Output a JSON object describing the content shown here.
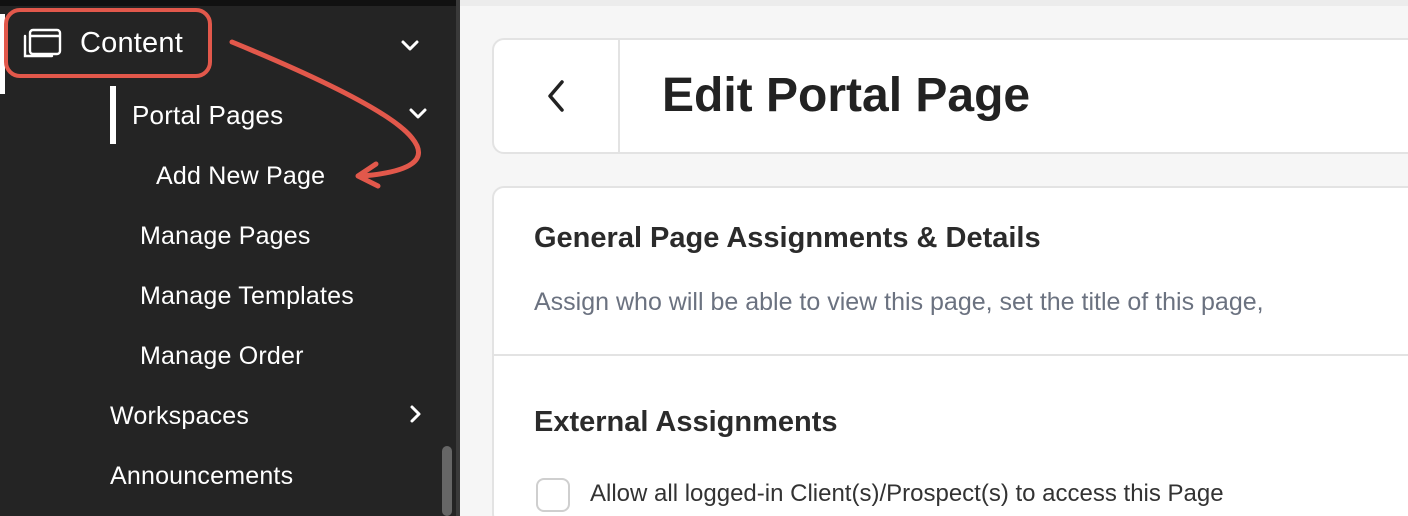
{
  "sidebar": {
    "content_label": "Content",
    "portal_pages_label": "Portal Pages",
    "items": [
      {
        "label": "Add New Page"
      },
      {
        "label": "Manage Pages"
      },
      {
        "label": "Manage Templates"
      },
      {
        "label": "Manage Order"
      }
    ],
    "workspaces_label": "Workspaces",
    "announcements_label": "Announcements"
  },
  "header": {
    "title": "Edit Portal Page"
  },
  "general_section": {
    "title": "General Page Assignments & Details",
    "description": "Assign who will be able to view this page, set the title of this page,"
  },
  "external_section": {
    "title": "External Assignments",
    "checkbox_label": "Allow all logged-in Client(s)/Prospect(s) to access this Page"
  },
  "colors": {
    "sidebar_bg": "#242424",
    "highlight": "#e2584b",
    "muted_text": "#6b7280"
  },
  "icons": {
    "content": "window-stack-icon",
    "back": "chevron-left-icon",
    "expand": "chevron-down-icon",
    "collapsed": "chevron-right-icon"
  }
}
